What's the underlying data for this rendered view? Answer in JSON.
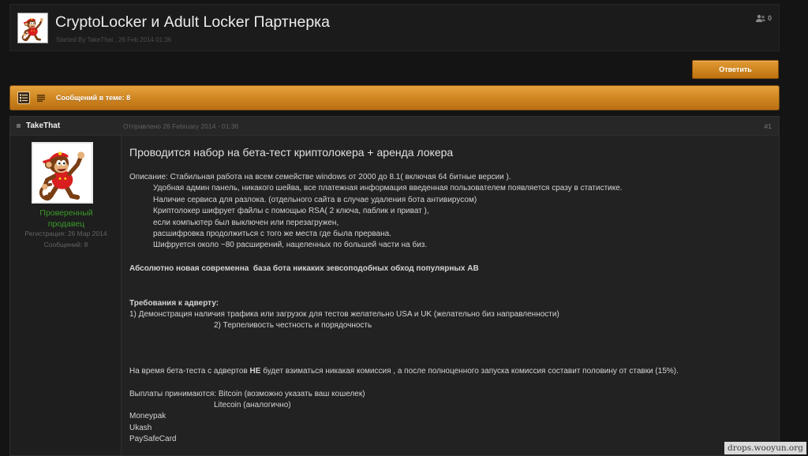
{
  "thread": {
    "title": "CryptoLocker и Adult Locker Партнерка",
    "started_by_prefix": "Started By ",
    "started_by_user": "TakeThat",
    "started_at": " , 26 Feb 2014 01:36",
    "followers_count": "0"
  },
  "reply_button": {
    "label": "Ответить"
  },
  "topic_bar": {
    "posts_count_label": "Сообщений в теме: 8"
  },
  "post": {
    "author": "TakeThat",
    "posted_at": "Отправлено 26 February 2014 - 01:36",
    "number": "#1",
    "author_group": "Проверенный продавец",
    "registered": "Регистрация: 26 Мар 2014",
    "post_count": "Сообщений: 8",
    "content": {
      "heading": "Проводится набор на бета-тест криптолокера + аренда локера",
      "description": "Описание: Стабильная работа на всем семействе windows от 2000 до 8.1( включая 64 битные версии ).",
      "features": [
        "Удобная админ панель, никакого шейва, все платежная информация введенная пользователем появляется сразу в статистике.",
        "Наличие сервиса для разлока. (отдельного сайта в случае удаления бота антивирусом)",
        "Криптолокер шифрует файлы с помощью RSA( 2 ключа, паблик и приват ),",
        "если компьютер был выключен или перезагружен,",
        "расшифровка продолжиться с того же места где была прервана.",
        "Шифруется около ~80 расширений, нацеленных по большей части на биз."
      ],
      "highlight": "Абсолютно новая современна  база бота никаких зевсоподобных обход популярных АВ",
      "requirements_heading": "Требования к адверту:",
      "requirements": [
        "1) Демонстрация наличия трафика или загрузок для тестов желательно USA и UK (желательно биз направленности)",
        "2) Терпеливость честность и порядочность"
      ],
      "commission": {
        "before": "На время бета-теста с адвертов ",
        "emphasis": "НЕ",
        "after": " будет взиматься никакая комиссия , а после полноценного запуска комиссия составит половину от ставки (15%)."
      },
      "payments_intro": "Выплаты принимаются: Bitcoin (возможно указать ваш кошелек)",
      "payments_extra": "Litecoin (аналогично)",
      "payment_methods": [
        "Moneypak",
        "Ukash",
        "PaySafeCard"
      ]
    }
  },
  "watermark": "drops.wooyun.org",
  "icons": {
    "followers": "users-icon",
    "view_full": "list-view-icon",
    "view_compact": "compact-view-icon",
    "post_marker": "bullet-icon",
    "avatar": "cartoon-monkey-avatar"
  },
  "colors": {
    "page_bg": "#141414",
    "header_bg": "#1b1b1b",
    "panel_bg": "#222222",
    "side_bg": "#1e1e1e",
    "text": "#d4d4d4",
    "muted": "#646464",
    "accent": "#e39b34",
    "accent_dark": "#bd720f",
    "group_green": "#3b9a29"
  }
}
